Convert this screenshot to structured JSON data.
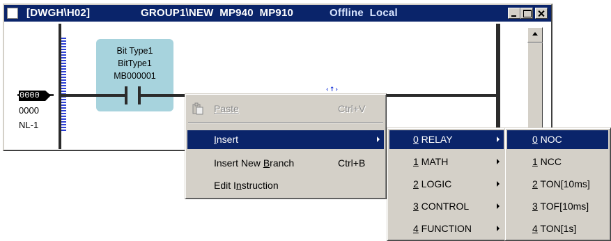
{
  "window": {
    "title_drawing": "[DWGH\\H02]",
    "title_group": "GROUP1\\NEW  MP940  MP910",
    "title_status": "Offline  Local",
    "icons": {
      "minimize": "minimize-icon",
      "maximize": "maximize-icon",
      "close": "close-icon"
    }
  },
  "ladder": {
    "step_number": "0000",
    "step_address": "0000",
    "step_label": "NL-1",
    "instruction": {
      "line1": "Bit Type1",
      "line2": "BitType1",
      "line3": "MB000001"
    },
    "cursor_marker": "‹↑›"
  },
  "context_menu": {
    "items": [
      {
        "label": "Paste",
        "mnemonic_index": 0,
        "shortcut": "Ctrl+V",
        "disabled": true,
        "icon": "paste-icon"
      },
      {
        "label": "Insert",
        "mnemonic_index": 0,
        "shortcut": "",
        "submenu": true,
        "highlighted": true
      },
      {
        "label": "Insert New Branch",
        "mnemonic_index": 11,
        "shortcut": "Ctrl+B"
      },
      {
        "label": "Edit Instruction",
        "mnemonic_index": 6,
        "shortcut": ""
      }
    ]
  },
  "insert_submenu": {
    "items": [
      {
        "num": "0",
        "label": " RELAY",
        "highlighted": true
      },
      {
        "num": "1",
        "label": " MATH"
      },
      {
        "num": "2",
        "label": " LOGIC"
      },
      {
        "num": "3",
        "label": " CONTROL"
      },
      {
        "num": "4",
        "label": " FUNCTION"
      }
    ]
  },
  "relay_submenu": {
    "items": [
      {
        "num": "0",
        "label": " NOC",
        "highlighted": true
      },
      {
        "num": "1",
        "label": " NCC"
      },
      {
        "num": "2",
        "label": " TON[10ms]"
      },
      {
        "num": "3",
        "label": " TOF[10ms]"
      },
      {
        "num": "4",
        "label": " TON[1s]"
      }
    ]
  }
}
